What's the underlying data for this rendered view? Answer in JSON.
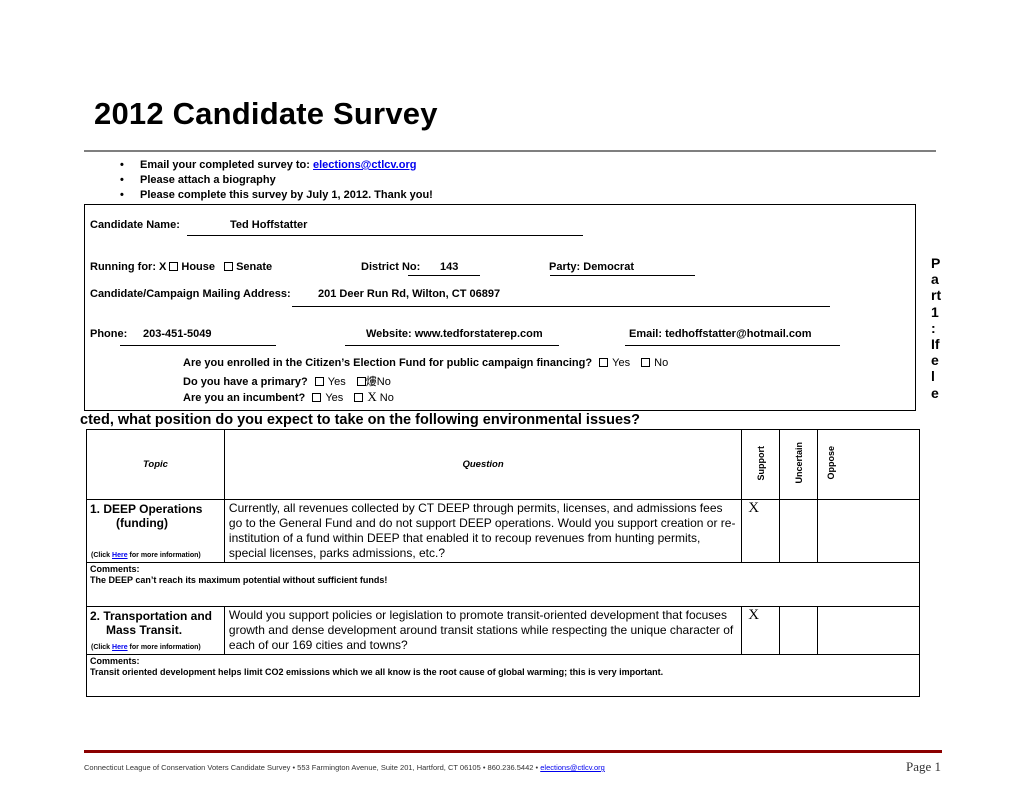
{
  "title": "2012 Candidate Survey",
  "bullets": {
    "email_prefix": "Email your completed survey to: ",
    "email_link": "elections@ctlcv.org",
    "biography": "Please attach a biography",
    "deadline": "Please complete this survey by July 1, 2012.  Thank you!"
  },
  "candidate": {
    "name_label": "Candidate Name:",
    "name_value": "Ted Hoffstatter",
    "running_label": "Running for: X",
    "house_label": "House",
    "senate_label": "Senate",
    "district_label": "District No:",
    "district_value": "143",
    "party_label": "Party:",
    "party_value": "Democrat",
    "address_label": "Candidate/Campaign Mailing Address:",
    "address_value": "201 Deer Run Rd, Wilton, CT  06897",
    "phone_label": "Phone:",
    "phone_value": "203-451-5049",
    "website_label": "Website:",
    "website_value": "www.tedforstaterep.com",
    "email_label": "Email:",
    "email_value": "tedhoffstatter@hotmail.com"
  },
  "questions_yn": [
    {
      "text": "Are you enrolled in the Citizen’s Election Fund for public campaign financing?",
      "yes": "Yes",
      "no": "No",
      "mark": ""
    },
    {
      "text": "Do you have a primary?",
      "yes": "Yes",
      "no": "No",
      "mark": "熡"
    },
    {
      "text": "Are you an incumbent?",
      "yes": "Yes",
      "no": "No",
      "mark": "X"
    }
  ],
  "side_heading": [
    "P",
    "a",
    "rt",
    "1",
    ":",
    "If",
    "e",
    "l",
    "e"
  ],
  "section_heading": "cted, what position do you expect to take on the following environmental issues?",
  "table": {
    "headers": {
      "topic": "Topic",
      "question": "Question",
      "support": "Support",
      "uncertain": "Uncertain",
      "oppose": "Oppose"
    },
    "comments_label": "Comments:",
    "click_prefix": "(Click ",
    "click_link": "Here",
    "click_suffix": " for more information)",
    "rows": [
      {
        "topic_line1": "1.   DEEP Operations",
        "topic_line2": "(funding)",
        "question": "Currently, all revenues collected by CT DEEP through permits, licenses, and admissions fees go to the General Fund and do not support DEEP operations.  Would you support creation or re-institution of a fund within DEEP that enabled it to recoup revenues from hunting permits, special licenses, parks admissions, etc.?",
        "support": "X",
        "uncertain": "",
        "oppose": "",
        "comment": "The DEEP can’t reach its maximum potential without sufficient funds!"
      },
      {
        "topic_line1": "2. Transportation and",
        "topic_line2": "Mass Transit.",
        "question": "Would you support policies or legislation to promote transit-oriented development that focuses growth and dense development around transit stations while respecting the unique character of each of our 169 cities and towns?",
        "support": "X",
        "uncertain": "",
        "oppose": "",
        "comment": "Transit oriented development helps limit CO2 emissions which we all know is the root cause of global warming; this is very important."
      }
    ]
  },
  "footer": {
    "text": "Connecticut League of Conservation Voters Candidate Survey  • 553 Farmington Avenue, Suite 201, Hartford, CT 06105 • 860.236.5442 •  ",
    "email_link": "elections@ctlcv.org",
    "page": "Page 1"
  },
  "colors": {
    "link": "#0000ee",
    "footer_rule": "#8b0000",
    "title_rule": "#7f7f7f"
  }
}
